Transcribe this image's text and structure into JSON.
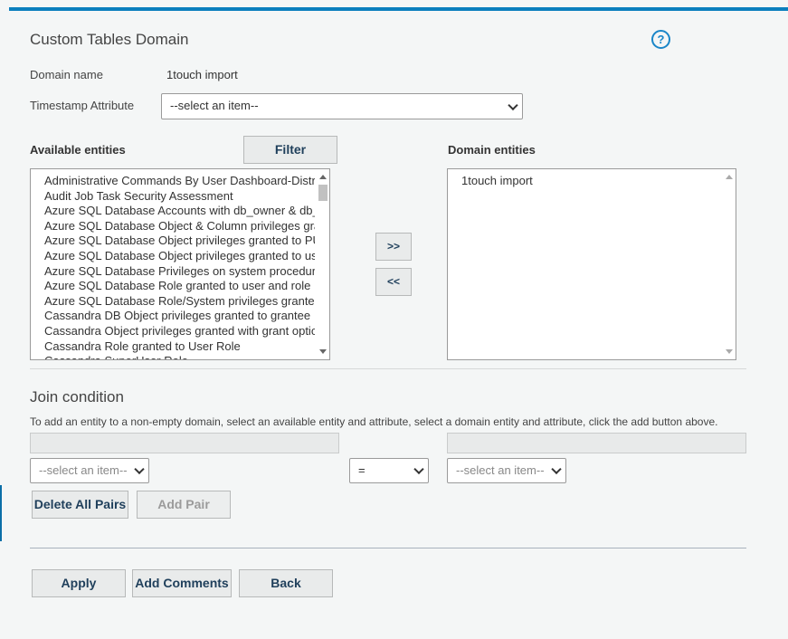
{
  "page": {
    "title": "Custom Tables Domain",
    "help_icon": "?"
  },
  "domain_name": {
    "label": "Domain name",
    "value": "1touch import"
  },
  "timestamp": {
    "label": "Timestamp Attribute",
    "selected": "--select an item--"
  },
  "available": {
    "label": "Available entities",
    "filter_label": "Filter",
    "items": [
      "Administrative Commands By User Dashboard-Distribution",
      "Audit Job Task Security Assessment",
      "Azure SQL Database Accounts with db_owner & db_",
      "Azure SQL Database Object & Column privileges granted",
      "Azure SQL Database Object privileges granted to PUBLIC",
      "Azure SQL Database Object privileges granted to user",
      "Azure SQL Database Privileges on system procedures",
      "Azure SQL Database Role granted to user and role",
      "Azure SQL Database Role/System privileges granted",
      "Cassandra DB Object privileges granted to grantee",
      "Cassandra Object privileges granted with grant option",
      "Cassandra Role granted to User Role",
      "Cassandra SuperUser Role"
    ]
  },
  "move": {
    "add_label": ">>",
    "remove_label": "<<"
  },
  "domain_entities": {
    "label": "Domain entities",
    "items": [
      "1touch import"
    ]
  },
  "join": {
    "title": "Join condition",
    "note": "To add an entity to a non-empty domain, select an available entity and attribute, select a domain entity and attribute, click the add button above.",
    "left_select": "--select an item--",
    "operator": "=",
    "right_select": "--select an item--",
    "delete_all_label": "Delete All Pairs",
    "add_pair_label": "Add Pair"
  },
  "actions": {
    "apply_label": "Apply",
    "comments_label": "Add Comments",
    "back_label": "Back"
  }
}
